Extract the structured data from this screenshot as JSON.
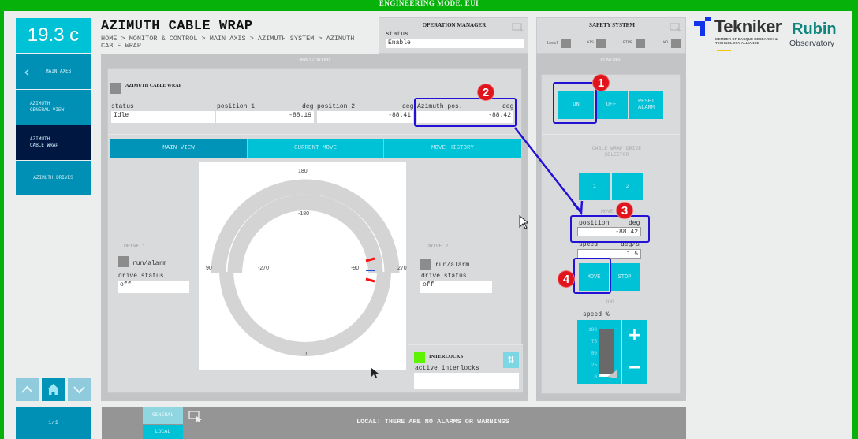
{
  "app": {
    "mode_banner": "ENGINEERING MODE. EUI",
    "temperature": "19.3 c",
    "page_title": "AZIMUTH CABLE WRAP",
    "breadcrumb": "HOME > MONITOR & CONTROL > MAIN AXIS > AZIMUTH SYSTEM > AZIMUTH CABLE WRAP"
  },
  "sidebar": {
    "items": [
      {
        "label": "MAIN AXES",
        "icon": "chevron-left-icon",
        "active": false
      },
      {
        "label": "AZIMUTH GENERAL VIEW",
        "active": false
      },
      {
        "label": "AZIMUTH CABLE WRAP",
        "active": true
      },
      {
        "label": "AZIMUTH DRIVES",
        "active": false
      }
    ],
    "page_indicator": "1/1",
    "nav_icons": [
      "chevron-up-icon",
      "home-icon",
      "chevron-down-icon"
    ]
  },
  "operation_manager": {
    "title": "OPERATION MANAGER",
    "status_label": "status",
    "status_value": "Enable"
  },
  "safety_system": {
    "title": "SAFETY SYSTEM",
    "indicators": [
      {
        "label": "local"
      },
      {
        "label": "GIS"
      },
      {
        "label": "ETPB"
      },
      {
        "label": "WD"
      }
    ]
  },
  "logos": {
    "tekniker": "Tekniker",
    "tekniker_sub": "MEMBER OF BASQUE RESEARCH & TECHNOLOGY ALLIANCE",
    "rubin": "Rubin",
    "rubin_sub": "Observatory"
  },
  "monitoring": {
    "header": "MONITORING",
    "section_title": "AZIMUTH CABLE WRAP",
    "fields": {
      "status": {
        "label": "status",
        "value": "Idle"
      },
      "position1": {
        "label": "position 1",
        "unit": "deg",
        "value": "-88.19"
      },
      "position2": {
        "label": "position 2",
        "unit": "deg",
        "value": "-88.41"
      },
      "azimuth_pos": {
        "label": "Azimuth pos.",
        "unit": "deg",
        "value": "-88.42"
      }
    },
    "tabs": [
      "MAIN VIEW",
      "CURRENT MOVE",
      "MOVE HISTORY"
    ],
    "active_tab": "MAIN VIEW",
    "dial": {
      "outer_labels": {
        "top": "180",
        "left": "90",
        "right": "270",
        "bottom": "0"
      },
      "inner_labels": {
        "top": "-180",
        "left": "-270",
        "right": "-90"
      }
    },
    "drive1": {
      "title": "DRIVE 1",
      "run_alarm": "run/alarm",
      "status_label": "drive status",
      "status_value": "off"
    },
    "drive2": {
      "title": "DRIVE 2",
      "run_alarm": "run/alarm",
      "status_label": "drive status",
      "status_value": "off"
    },
    "interlocks": {
      "title": "INTERLOCKS",
      "active_label": "active interlocks",
      "active_value": "",
      "indicator_color": "#5cf400"
    }
  },
  "control": {
    "header": "CONTROL",
    "power_buttons": [
      "ON",
      "OFF",
      "RESET ALARM"
    ],
    "drive_selector_title": "CABLE WRAP DRIVE SELECTOR",
    "drive_buttons": [
      "1",
      "2"
    ],
    "move_title": "MOVE",
    "position": {
      "label": "position",
      "unit": "deg",
      "value": "-88.42"
    },
    "speed": {
      "label": "speed",
      "unit": "deg/s",
      "value": "1.5"
    },
    "move_buttons": [
      "MOVE",
      "STOP"
    ],
    "jog_title": "JOG",
    "jog_speed_label": "speed %",
    "jog_scale": [
      "100",
      "75",
      "50",
      "25",
      "0"
    ],
    "jog_speed_percent": 0,
    "jog_plus": "+",
    "jog_minus": "−"
  },
  "alarm_bar": {
    "tabs": [
      "GENERAL",
      "LOCAL"
    ],
    "active_tab": "LOCAL",
    "message": "LOCAL: THERE ARE NO ALARMS OR WARNINGS"
  },
  "annotations": [
    "1",
    "2",
    "3",
    "4"
  ],
  "colors": {
    "accent": "#00c2d6",
    "accent_dark": "#008fb5",
    "nav_active": "#001742",
    "banner": "#06b20a",
    "annotation": "#2411d6",
    "badge": "#e0141a"
  }
}
